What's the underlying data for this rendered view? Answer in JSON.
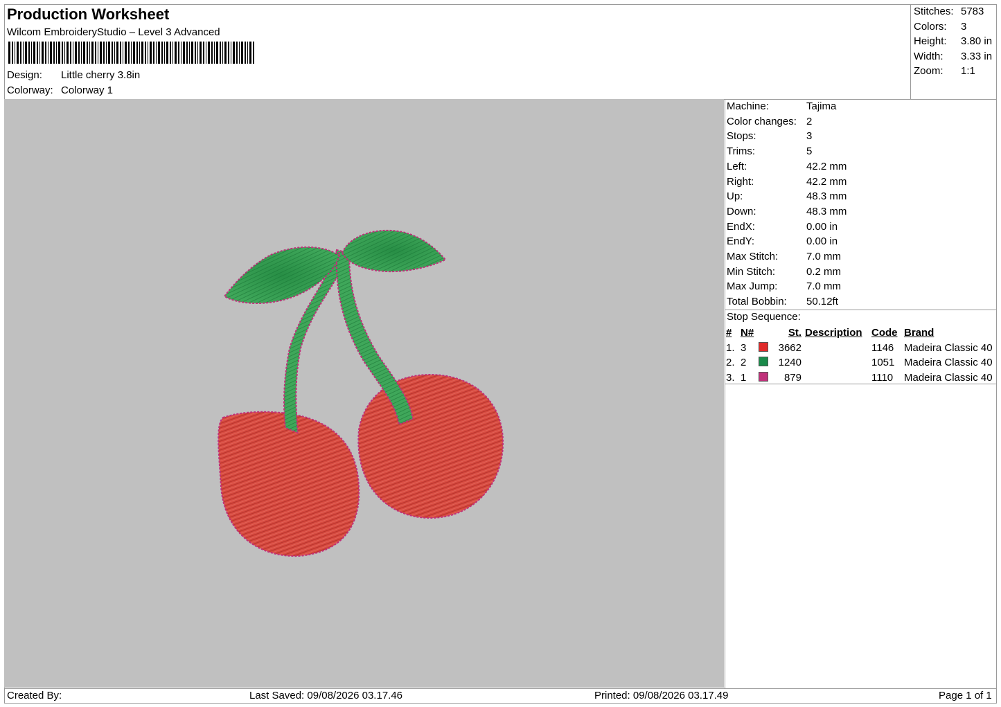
{
  "header": {
    "title": "Production Worksheet",
    "subtitle": "Wilcom EmbroideryStudio – Level 3 Advanced",
    "design_label": "Design:",
    "design_value": "Little cherry 3.8in",
    "colorway_label": "Colorway:",
    "colorway_value": "Colorway 1"
  },
  "summary": [
    {
      "label": "Stitches:",
      "value": "5783"
    },
    {
      "label": "Colors:",
      "value": "3"
    },
    {
      "label": "Height:",
      "value": "3.80 in"
    },
    {
      "label": "Width:",
      "value": "3.33 in"
    },
    {
      "label": "Zoom:",
      "value": "1:1"
    }
  ],
  "machine_info": [
    {
      "label": "Machine:",
      "value": "Tajima"
    },
    {
      "label": "Color changes:",
      "value": "2"
    },
    {
      "label": "Stops:",
      "value": "3"
    },
    {
      "label": "Trims:",
      "value": "5"
    },
    {
      "label": "Left:",
      "value": "42.2 mm"
    },
    {
      "label": "Right:",
      "value": "42.2 mm"
    },
    {
      "label": "Up:",
      "value": "48.3 mm"
    },
    {
      "label": "Down:",
      "value": "48.3 mm"
    },
    {
      "label": "EndX:",
      "value": "0.00 in"
    },
    {
      "label": "EndY:",
      "value": "0.00 in"
    },
    {
      "label": "Max Stitch:",
      "value": "7.0 mm"
    },
    {
      "label": "Min Stitch:",
      "value": "0.2 mm"
    },
    {
      "label": "Max Jump:",
      "value": "7.0 mm"
    },
    {
      "label": "Total Bobbin:",
      "value": "50.12ft"
    }
  ],
  "stop_sequence": {
    "heading": "Stop Sequence:",
    "columns": [
      "#",
      "N#",
      "St.",
      "Description",
      "Code",
      "Brand"
    ],
    "rows": [
      {
        "index": "1.",
        "needle": "3",
        "color": "#e02a2a",
        "stitches": "3662",
        "description": "",
        "code": "1146",
        "brand": "Madeira Classic 40"
      },
      {
        "index": "2.",
        "needle": "2",
        "color": "#1a8a4a",
        "stitches": "1240",
        "description": "",
        "code": "1051",
        "brand": "Madeira Classic 40"
      },
      {
        "index": "3.",
        "needle": "1",
        "color": "#c0307a",
        "stitches": "879",
        "description": "",
        "code": "1110",
        "brand": "Madeira Classic 40"
      }
    ]
  },
  "colors": {
    "canvas_bg": "#c0c0c0",
    "cherry_red": "#d84a40",
    "leaf_green": "#3fa75a",
    "outline": "#c0307a"
  },
  "footer": {
    "created_by": "Created By:",
    "last_saved": "Last Saved: 09/08/2026 03.17.46",
    "printed": "Printed: 09/08/2026 03.17.49",
    "page": "Page 1 of 1"
  }
}
